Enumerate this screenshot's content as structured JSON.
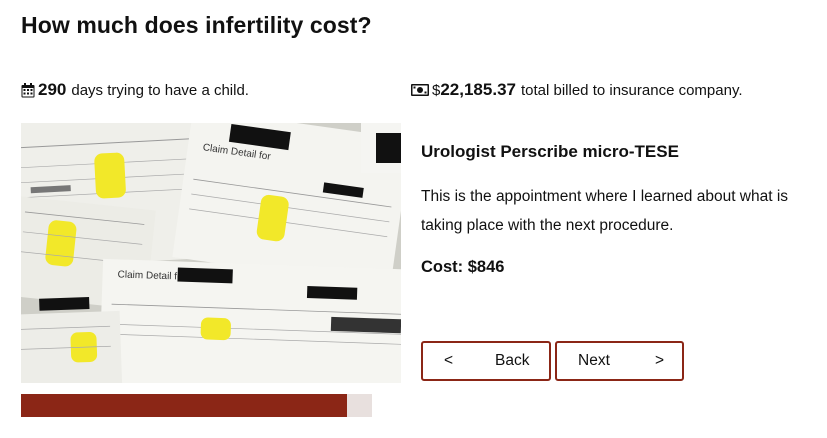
{
  "page": {
    "title": "How much does infertility cost?"
  },
  "stats": {
    "days": {
      "icon": "calendar-icon",
      "value": "290",
      "label": "days trying to have a child."
    },
    "billed": {
      "icon": "money-bill-icon",
      "currency": "$",
      "value": "22,185.37",
      "label": "total billed to insurance company."
    }
  },
  "progress": {
    "fraction": 0.93,
    "color": "#8b2616"
  },
  "step": {
    "title": "Urologist Perscribe micro-TESE",
    "description": "This is the appointment where I learned about what is taking place with the next procedure.",
    "cost_label": "Cost: $846"
  },
  "nav": {
    "back_chevron": "<",
    "back_label": "Back",
    "next_label": "Next",
    "next_chevron": ">"
  },
  "colors": {
    "accent": "#8b2616",
    "highlight": "#f2e829"
  }
}
